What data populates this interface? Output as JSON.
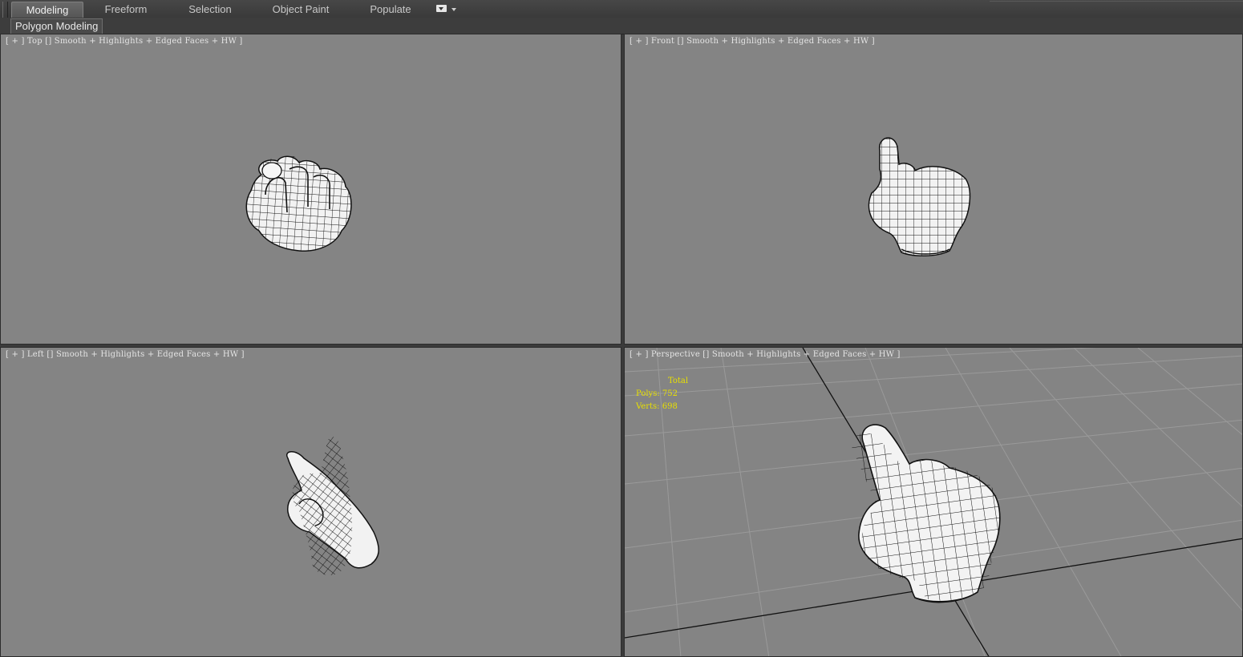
{
  "ribbon": {
    "tabs": [
      {
        "label": "Modeling",
        "active": true
      },
      {
        "label": "Freeform",
        "active": false
      },
      {
        "label": "Selection",
        "active": false
      },
      {
        "label": "Object Paint",
        "active": false
      },
      {
        "label": "Populate",
        "active": false
      }
    ],
    "panel_label": "Polygon Modeling",
    "dropdown_icon": "dropdown-arrow-icon"
  },
  "viewports": {
    "top": {
      "label": "[ + ] Top [] Smooth + Highlights + Edged Faces + HW ]"
    },
    "front": {
      "label": "[ + ] Front [] Smooth + Highlights + Edged Faces + HW ]"
    },
    "left": {
      "label": "[ + ] Left [] Smooth + Highlights + Edged Faces + HW ]"
    },
    "perspective": {
      "label": "[ + ] Perspective [] Smooth + Highlights + Edged Faces + HW ]",
      "stats": {
        "title": "Total",
        "polys_label": "Polys:",
        "polys": "752",
        "verts_label": "Verts:",
        "verts": "698"
      }
    }
  },
  "colors": {
    "viewport_bg": "#848484",
    "stats_text": "#e8e000",
    "mesh_fill": "#f4f4f4",
    "mesh_wire": "#111111"
  }
}
